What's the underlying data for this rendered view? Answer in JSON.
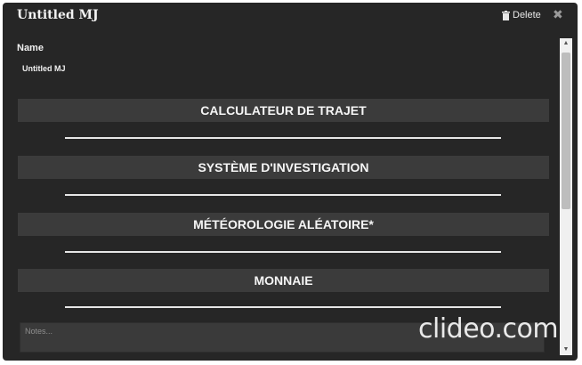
{
  "dialog": {
    "title": "Untitled MJ",
    "delete_label": "Delete",
    "close_glyph": "✖"
  },
  "form": {
    "name_label": "Name",
    "name_value": "Untitled MJ",
    "sections": [
      {
        "label": "CALCULATEUR DE TRAJET"
      },
      {
        "label": "SYSTÈME D'INVESTIGATION"
      },
      {
        "label": "MÉTÉOROLOGIE ALÉATOIRE*"
      },
      {
        "label": "MONNAIE"
      }
    ],
    "notes_placeholder": "Notes..."
  },
  "scrollbar": {
    "up_glyph": "▲",
    "down_glyph": "▼"
  },
  "watermark": {
    "text": "clideo.com"
  },
  "colors": {
    "dialog_bg": "#262626",
    "section_bg": "#3b3b3b",
    "text": "#f5f5f5"
  }
}
